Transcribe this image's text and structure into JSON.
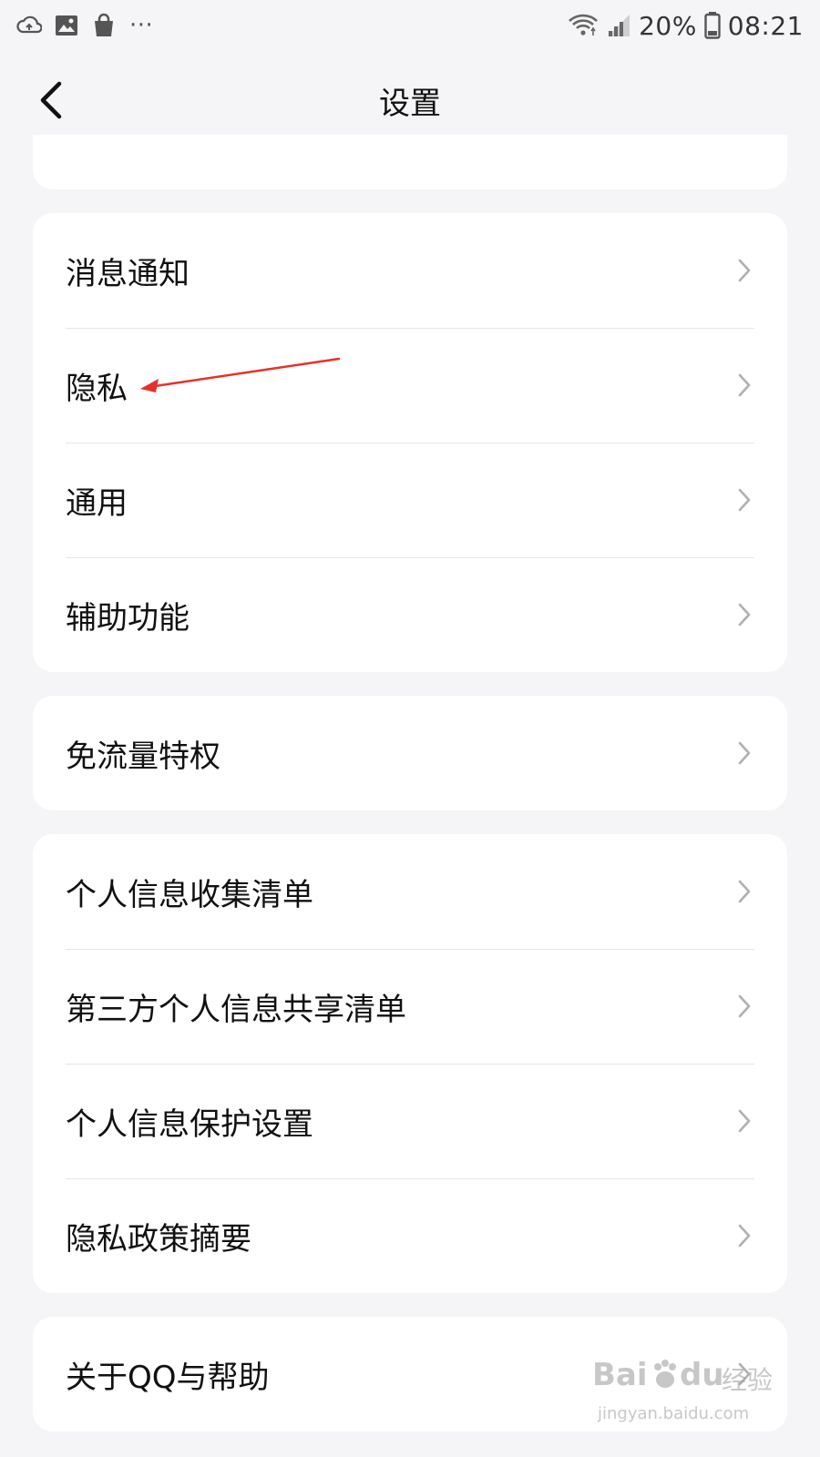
{
  "status_bar": {
    "battery_percent": "20%",
    "time": "08:21",
    "more_indicator": "···",
    "left_icons": [
      "cloud-sync-icon",
      "gallery-icon",
      "shopping-bag-icon"
    ],
    "right_icons": [
      "wifi-icon",
      "signal-icon",
      "battery-icon"
    ]
  },
  "header": {
    "title": "设置",
    "back_icon": "chevron-left-icon"
  },
  "groups": [
    {
      "items": [
        {
          "label": "消息通知"
        },
        {
          "label": "隐私"
        },
        {
          "label": "通用"
        },
        {
          "label": "辅助功能"
        }
      ]
    },
    {
      "items": [
        {
          "label": "免流量特权"
        }
      ]
    },
    {
      "items": [
        {
          "label": "个人信息收集清单"
        },
        {
          "label": "第三方个人信息共享清单"
        },
        {
          "label": "个人信息保护设置"
        },
        {
          "label": "隐私政策摘要"
        }
      ]
    },
    {
      "items": [
        {
          "label": "关于QQ与帮助"
        }
      ]
    }
  ],
  "watermark": {
    "brand": "Bai",
    "brand_suffix": "du",
    "cn_label": "经验",
    "url": "jingyan.baidu.com"
  },
  "colors": {
    "background": "#f5f5f7",
    "card": "#ffffff",
    "divider": "#e6e6e6",
    "chevron": "#b0b0b0",
    "annotation": "#e8302a"
  }
}
